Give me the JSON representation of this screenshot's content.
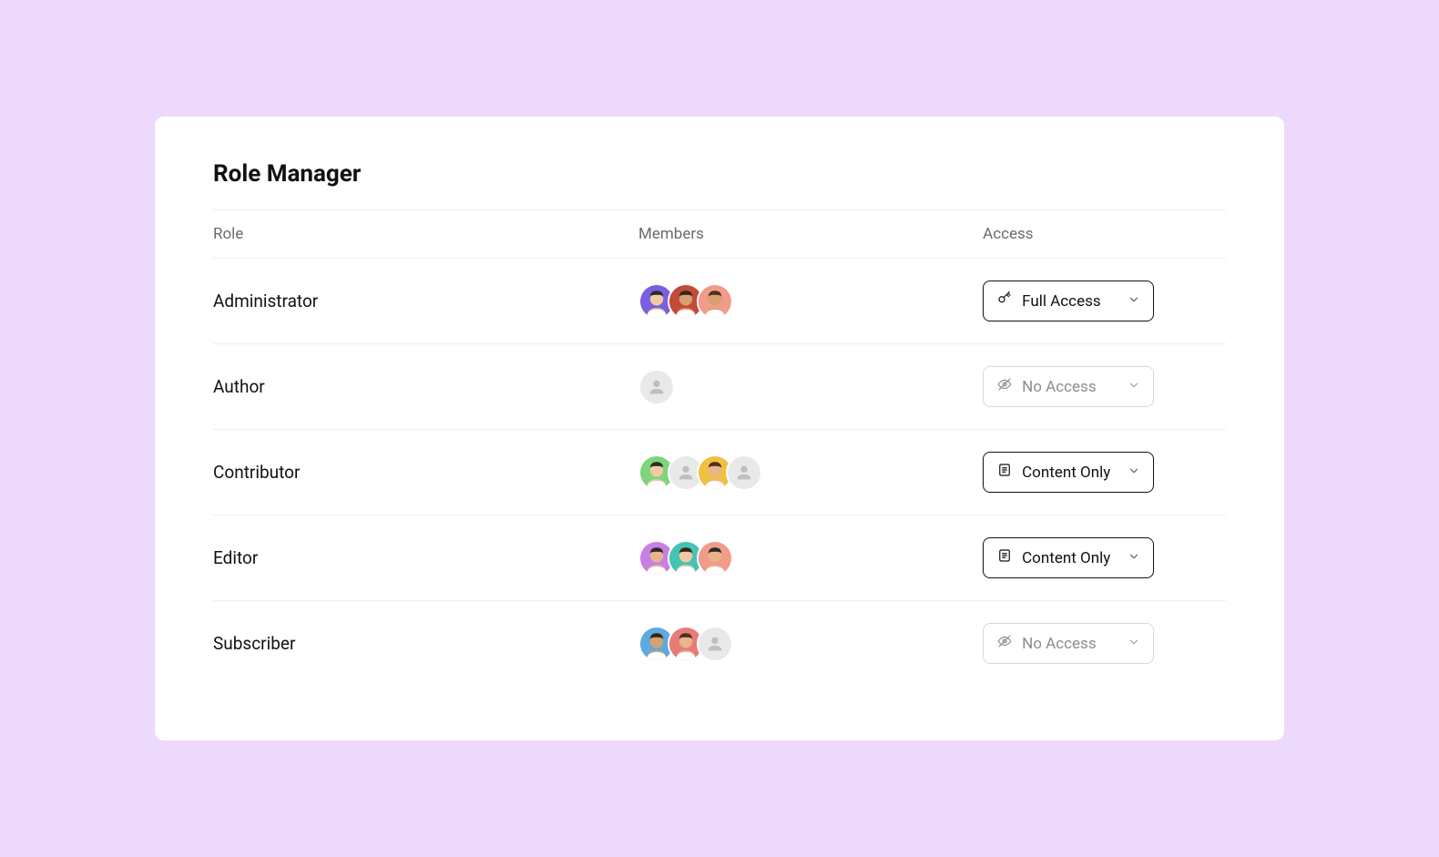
{
  "title": "Role Manager",
  "columns": {
    "role": "Role",
    "members": "Members",
    "access": "Access"
  },
  "access_labels": {
    "full": "Full Access",
    "none": "No Access",
    "content": "Content Only"
  },
  "roles": [
    {
      "name": "Administrator",
      "access": "full",
      "access_active": true,
      "members": [
        {
          "type": "person",
          "bg": "#7a5fe0"
        },
        {
          "type": "person",
          "bg": "#c14a3a"
        },
        {
          "type": "person",
          "bg": "#f19b8a"
        }
      ]
    },
    {
      "name": "Author",
      "access": "none",
      "access_active": false,
      "members": [
        {
          "type": "placeholder"
        }
      ]
    },
    {
      "name": "Contributor",
      "access": "content",
      "access_active": true,
      "members": [
        {
          "type": "person",
          "bg": "#7ed57b"
        },
        {
          "type": "placeholder"
        },
        {
          "type": "person",
          "bg": "#f0c040"
        },
        {
          "type": "placeholder"
        }
      ]
    },
    {
      "name": "Editor",
      "access": "content",
      "access_active": true,
      "members": [
        {
          "type": "person",
          "bg": "#c77fe6"
        },
        {
          "type": "person",
          "bg": "#45c3b5"
        },
        {
          "type": "person",
          "bg": "#f19b8a"
        }
      ]
    },
    {
      "name": "Subscriber",
      "access": "none",
      "access_active": false,
      "members": [
        {
          "type": "person",
          "bg": "#5da9e0"
        },
        {
          "type": "person",
          "bg": "#e77b77"
        },
        {
          "type": "placeholder"
        }
      ]
    }
  ]
}
